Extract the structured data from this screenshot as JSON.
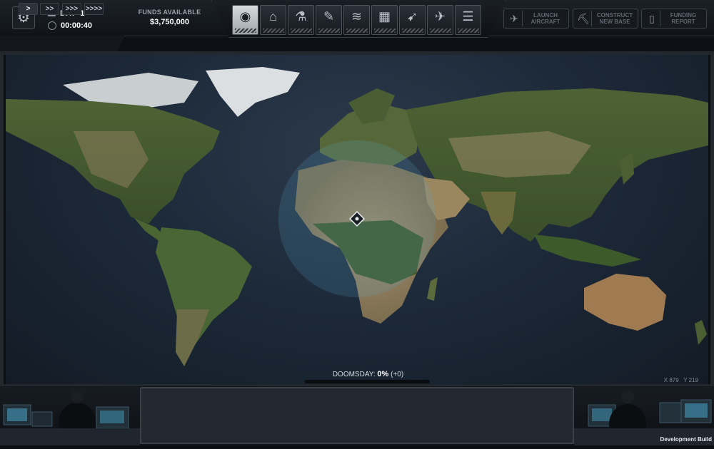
{
  "top": {
    "day_label": "DAY",
    "day_number": "1",
    "time": "00:00:40",
    "funds_label": "FUNDS AVAILABLE",
    "funds_value": "$3,750,000",
    "nav_tabs": [
      {
        "icon": "globe-icon",
        "glyph": "◉"
      },
      {
        "icon": "hangar-icon",
        "glyph": "⌂"
      },
      {
        "icon": "microscope-icon",
        "glyph": "⚗"
      },
      {
        "icon": "wrench-icon",
        "glyph": "✎"
      },
      {
        "icon": "rank-chevrons-icon",
        "glyph": "≋"
      },
      {
        "icon": "crates-icon",
        "glyph": "▦"
      },
      {
        "icon": "rifle-icon",
        "glyph": "➹"
      },
      {
        "icon": "jet-icon",
        "glyph": "✈"
      },
      {
        "icon": "documents-icon",
        "glyph": "☰"
      }
    ],
    "actions": {
      "launch": "LAUNCH\nAIRCRAFT",
      "construct": "CONSTRUCT\nNEW BASE",
      "funding": "FUNDING\nREPORT"
    }
  },
  "speed": [
    ">",
    ">>",
    ">>>",
    ">>>>"
  ],
  "doomsday": {
    "label": "DOOMSDAY:",
    "value": "0%",
    "delta": "(+0)"
  },
  "coords": {
    "x": "X 879",
    "y": "Y 219"
  },
  "footer": {
    "dev_build": "Development Build"
  },
  "colors": {
    "ocean": "#1d2a3a",
    "land_green": "#3d5a2a",
    "desert": "#8c7a5a",
    "ice": "#d9dde0",
    "radar": "#5aa6c8"
  }
}
